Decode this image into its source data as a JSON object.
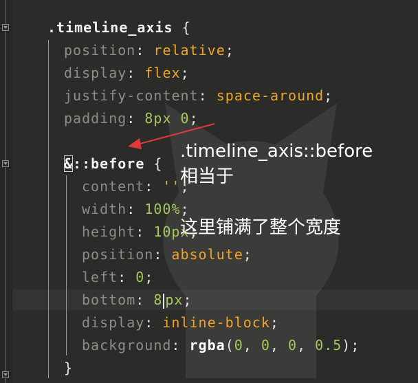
{
  "editor": {
    "code_lines": [
      {
        "segments": [
          {
            "c": "sel",
            "t": ".timeline_axis"
          },
          {
            "c": "punc",
            "t": " {"
          }
        ]
      },
      {
        "segments": [
          {
            "c": "prop",
            "t": "position"
          },
          {
            "c": "punc",
            "t": ": "
          },
          {
            "c": "kw",
            "t": "relative"
          },
          {
            "c": "punc",
            "t": ";"
          }
        ]
      },
      {
        "segments": [
          {
            "c": "prop",
            "t": "display"
          },
          {
            "c": "punc",
            "t": ": "
          },
          {
            "c": "kw",
            "t": "flex"
          },
          {
            "c": "punc",
            "t": ";"
          }
        ]
      },
      {
        "segments": [
          {
            "c": "prop",
            "t": "justify-content"
          },
          {
            "c": "punc",
            "t": ": "
          },
          {
            "c": "kw",
            "t": "space-around"
          },
          {
            "c": "punc",
            "t": ";"
          }
        ]
      },
      {
        "segments": [
          {
            "c": "prop",
            "t": "padding"
          },
          {
            "c": "punc",
            "t": ": "
          },
          {
            "c": "num",
            "t": "8px 0"
          },
          {
            "c": "punc",
            "t": ";"
          }
        ]
      },
      {
        "segments": []
      },
      {
        "segments": [
          {
            "c": "amp",
            "t": "&"
          },
          {
            "c": "sel",
            "t": "::before"
          },
          {
            "c": "punc",
            "t": " {"
          }
        ]
      },
      {
        "segments": [
          {
            "c": "prop",
            "t": "content"
          },
          {
            "c": "punc",
            "t": ": "
          },
          {
            "c": "str",
            "t": "''"
          },
          {
            "c": "punc",
            "t": ";"
          }
        ]
      },
      {
        "segments": [
          {
            "c": "prop",
            "t": "width"
          },
          {
            "c": "punc",
            "t": ": "
          },
          {
            "c": "num",
            "t": "100%"
          },
          {
            "c": "punc",
            "t": ";"
          }
        ]
      },
      {
        "segments": [
          {
            "c": "prop",
            "t": "height"
          },
          {
            "c": "punc",
            "t": ": "
          },
          {
            "c": "num",
            "t": "10px"
          },
          {
            "c": "punc",
            "t": ";"
          }
        ]
      },
      {
        "segments": [
          {
            "c": "prop",
            "t": "position"
          },
          {
            "c": "punc",
            "t": ": "
          },
          {
            "c": "kw",
            "t": "absolute"
          },
          {
            "c": "punc",
            "t": ";"
          }
        ]
      },
      {
        "segments": [
          {
            "c": "prop",
            "t": "left"
          },
          {
            "c": "punc",
            "t": ": "
          },
          {
            "c": "num",
            "t": "0"
          },
          {
            "c": "punc",
            "t": ";"
          }
        ]
      },
      {
        "segments": [
          {
            "c": "prop",
            "t": "bottom"
          },
          {
            "c": "punc",
            "t": ": "
          },
          {
            "c": "num",
            "t": "8"
          },
          {
            "c": "cursor",
            "t": ""
          },
          {
            "c": "num",
            "t": "px"
          },
          {
            "c": "punc",
            "t": ";"
          }
        ]
      },
      {
        "segments": [
          {
            "c": "prop",
            "t": "display"
          },
          {
            "c": "punc",
            "t": ": "
          },
          {
            "c": "kw",
            "t": "inline-block"
          },
          {
            "c": "punc",
            "t": ";"
          }
        ]
      },
      {
        "segments": [
          {
            "c": "prop",
            "t": "background"
          },
          {
            "c": "punc",
            "t": ": "
          },
          {
            "c": "fn",
            "t": "rgba"
          },
          {
            "c": "punc",
            "t": "("
          },
          {
            "c": "num",
            "t": "0"
          },
          {
            "c": "punc",
            "t": ", "
          },
          {
            "c": "num",
            "t": "0"
          },
          {
            "c": "punc",
            "t": ", "
          },
          {
            "c": "num",
            "t": "0"
          },
          {
            "c": "punc",
            "t": ", "
          },
          {
            "c": "num",
            "t": "0.5"
          },
          {
            "c": "punc",
            "t": ");"
          }
        ]
      },
      {
        "segments": [
          {
            "c": "punc",
            "t": "}"
          }
        ]
      }
    ]
  },
  "annotation": {
    "line1": ".timeline_axis::before",
    "line2": "相当于",
    "line3": "这里铺满了整个宽度",
    "color": "#ffffff",
    "arrow_color": "#e23a3a"
  }
}
